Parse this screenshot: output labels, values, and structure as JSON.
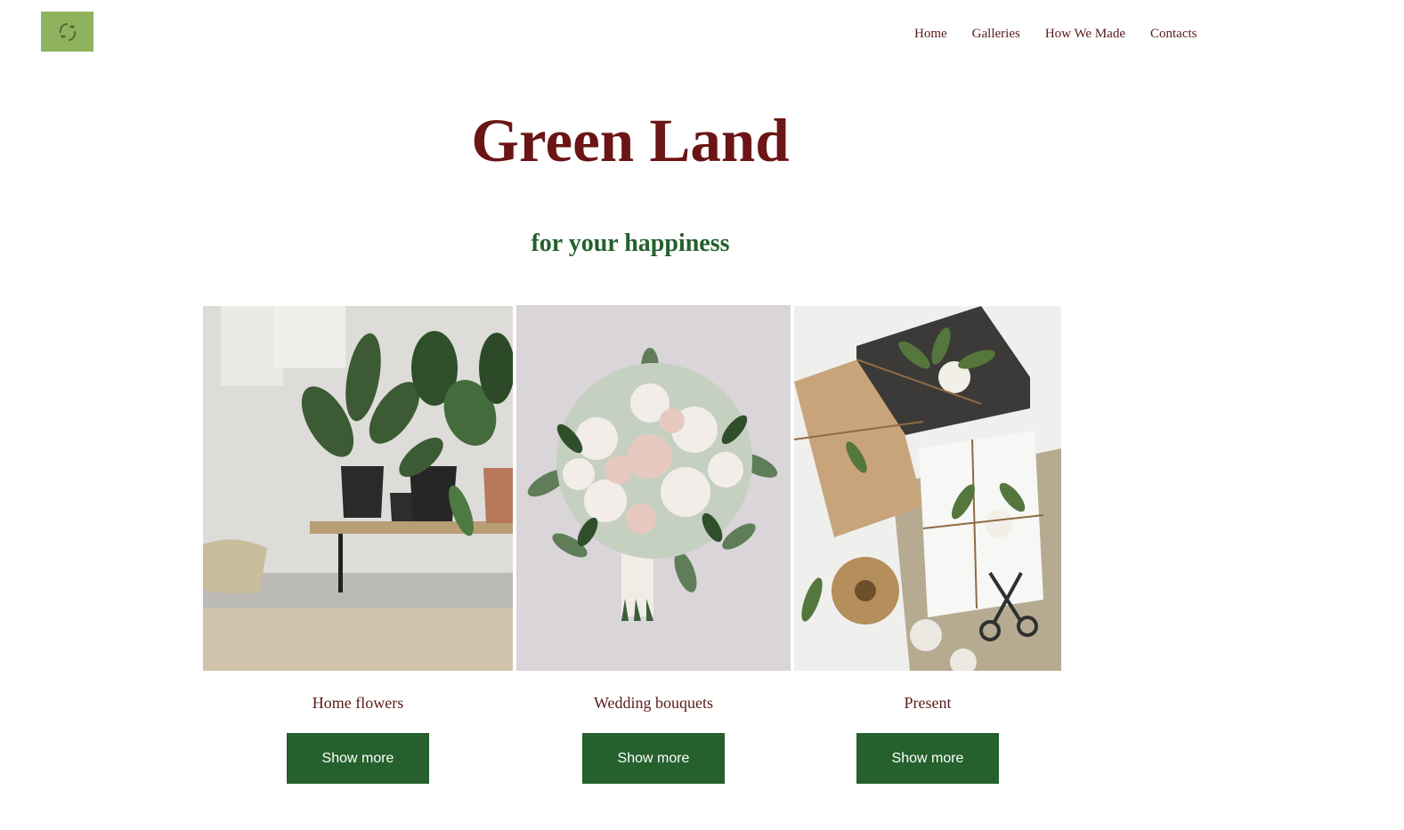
{
  "nav": {
    "items": [
      {
        "label": "Home"
      },
      {
        "label": "Galleries"
      },
      {
        "label": "How We Made"
      },
      {
        "label": "Contacts"
      }
    ]
  },
  "hero": {
    "title": "Green Land",
    "subtitle": "for your happiness"
  },
  "cards": [
    {
      "label": "Home flowers",
      "button": "Show more"
    },
    {
      "label": "Wedding bouquets",
      "button": "Show more"
    },
    {
      "label": "Present",
      "button": "Show more"
    }
  ],
  "colors": {
    "title": "#6b1515",
    "accent_green": "#25602d",
    "nav_text": "#5a1a1a",
    "logo_bg": "#8fb25e"
  },
  "icons": {
    "logo": "leaf-wreath-logo"
  }
}
